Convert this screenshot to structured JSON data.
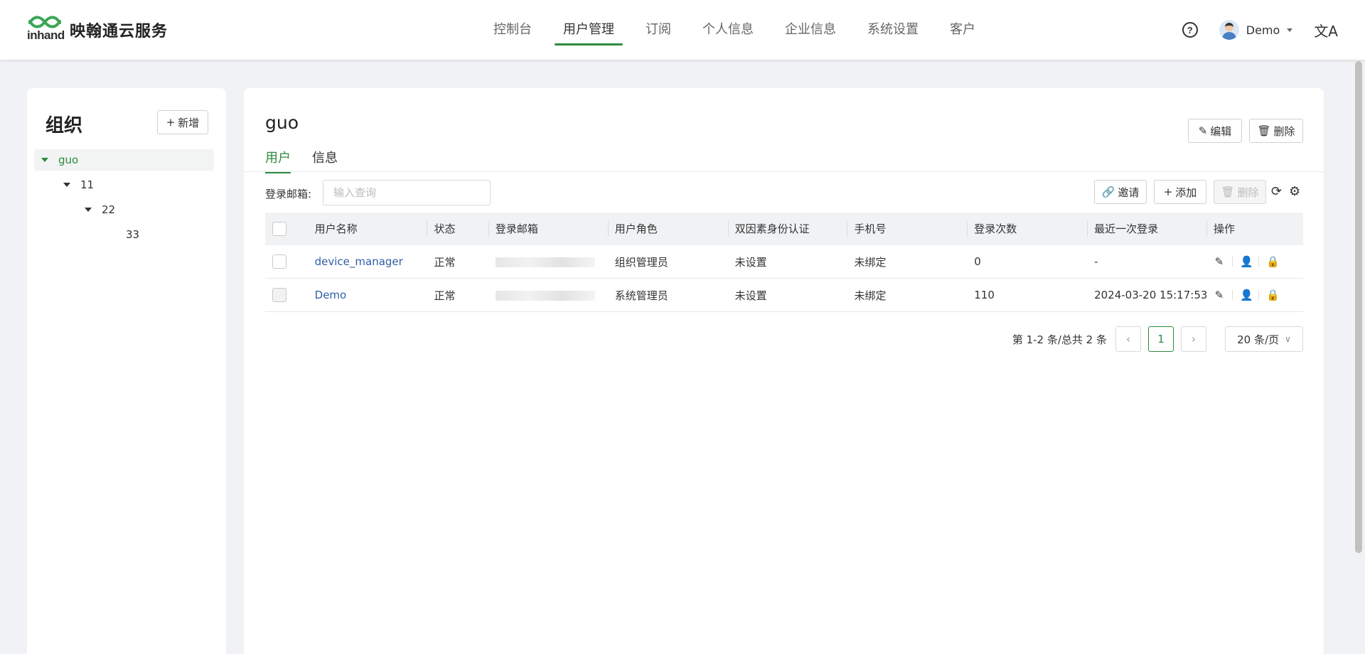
{
  "brand": {
    "logo_text": "inhand",
    "name": "映翰通云服务"
  },
  "nav": {
    "items": [
      {
        "label": "控制台"
      },
      {
        "label": "用户管理",
        "active": true
      },
      {
        "label": "订阅"
      },
      {
        "label": "个人信息"
      },
      {
        "label": "企业信息"
      },
      {
        "label": "系统设置"
      },
      {
        "label": "客户"
      }
    ]
  },
  "header": {
    "help_symbol": "?",
    "user_name": "Demo",
    "lang_symbol": "文A"
  },
  "org_panel": {
    "title": "组织",
    "add_label": "新增",
    "tree": [
      {
        "label": "guo",
        "level": 0,
        "expanded": true,
        "selected": true
      },
      {
        "label": "11",
        "level": 1,
        "expanded": true
      },
      {
        "label": "22",
        "level": 2,
        "expanded": true
      },
      {
        "label": "33",
        "level": 3
      }
    ]
  },
  "main": {
    "title": "guo",
    "edit_label": "编辑",
    "delete_label": "删除",
    "tabs": [
      {
        "label": "用户",
        "active": true
      },
      {
        "label": "信息"
      }
    ],
    "filter": {
      "label": "登录邮箱:",
      "placeholder": "输入查询"
    },
    "toolbar": {
      "invite_label": "邀请",
      "add_label": "添加",
      "delete_label": "删除"
    },
    "table": {
      "columns": [
        "用户名称",
        "状态",
        "登录邮箱",
        "用户角色",
        "双因素身份认证",
        "手机号",
        "登录次数",
        "最近一次登录",
        "操作"
      ],
      "rows": [
        {
          "name": "device_manager",
          "status": "正常",
          "email": "",
          "role": "组织管理员",
          "two_factor": "未设置",
          "phone": "未绑定",
          "login_count": "0",
          "last_login": "-"
        },
        {
          "name": "Demo",
          "status": "正常",
          "email": "",
          "role": "系统管理员",
          "two_factor": "未设置",
          "phone": "未绑定",
          "login_count": "110",
          "last_login": "2024-03-20 15:17:53"
        }
      ]
    },
    "pagination": {
      "summary": "第 1-2 条/总共 2 条",
      "current_page": "1",
      "page_size": "20 条/页"
    }
  },
  "colors": {
    "accent": "#2e8b3f",
    "link": "#2f5ea6",
    "highlight_box": "#e0202a"
  }
}
